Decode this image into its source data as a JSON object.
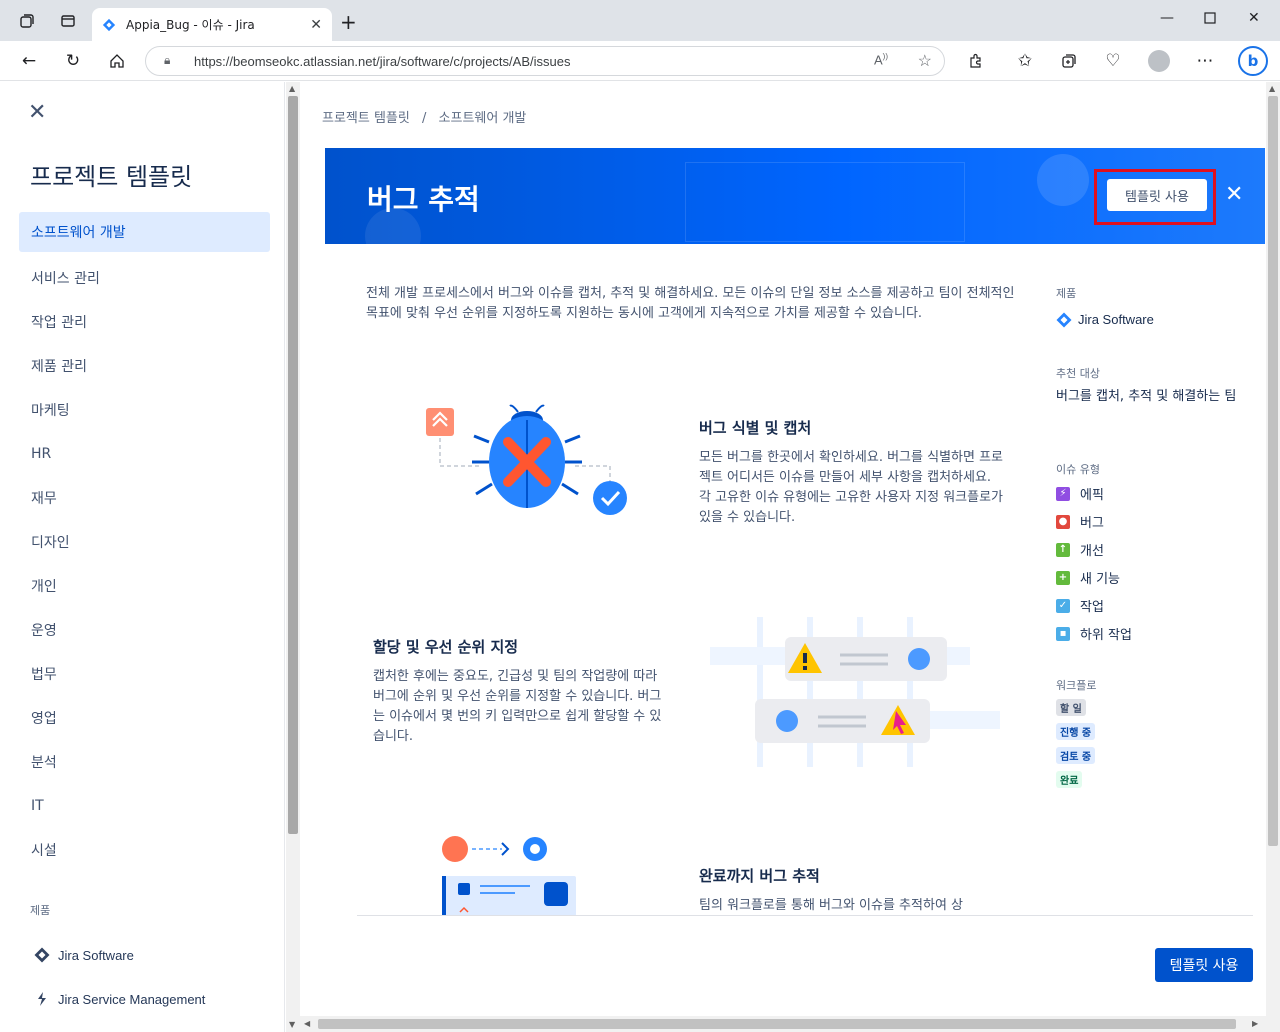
{
  "browser": {
    "tab_title": "Appia_Bug - 이슈 - Jira",
    "url": "https://beomseokc.atlassian.net/jira/software/c/projects/AB/issues"
  },
  "sidebar": {
    "title": "프로젝트 템플릿",
    "items": [
      {
        "label": "소프트웨어 개발",
        "active": true
      },
      {
        "label": "서비스 관리"
      },
      {
        "label": "작업 관리"
      },
      {
        "label": "제품 관리"
      },
      {
        "label": "마케팅"
      },
      {
        "label": "HR"
      },
      {
        "label": "재무"
      },
      {
        "label": "디자인"
      },
      {
        "label": "개인"
      },
      {
        "label": "운영"
      },
      {
        "label": "법무"
      },
      {
        "label": "영업"
      },
      {
        "label": "분석"
      },
      {
        "label": "IT"
      },
      {
        "label": "시설"
      }
    ],
    "products_label": "제품",
    "products": [
      "Jira Software",
      "Jira Service Management"
    ]
  },
  "breadcrumb": {
    "root": "프로젝트 템플릿",
    "separator": "/",
    "current": "소프트웨어 개발"
  },
  "banner": {
    "title": "버그 추적",
    "use_template_button": "템플릿 사용"
  },
  "description": "전체 개발 프로세스에서 버그와 이슈를 캡처, 추적 및 해결하세요. 모든 이슈의 단일 정보 소스를 제공하고 팀이 전체적인 목표에 맞춰 우선 순위를 지정하도록 지원하는 동시에 고객에게 지속적으로 가치를 제공할 수 있습니다.",
  "sections": [
    {
      "title": "버그 식별 및 캡처",
      "text": "모든 버그를 한곳에서 확인하세요. 버그를 식별하면 프로젝트 어디서든 이슈를 만들어 세부 사항을 캡처하세요. 각 고유한 이슈 유형에는 고유한 사용자 지정 워크플로가 있을 수 있습니다."
    },
    {
      "title": "할당 및 우선 순위 지정",
      "text": "캡처한 후에는 중요도, 긴급성 및 팀의 작업량에 따라 버그에 순위 및 우선 순위를 지정할 수 있습니다. 버그는 이슈에서 몇 번의 키 입력만으로 쉽게 할당할 수 있습니다."
    },
    {
      "title": "완료까지 버그 추적",
      "text": "팀의 워크플로를 통해 버그와 이슈를 추적하여 상"
    }
  ],
  "info": {
    "product_label": "제품",
    "product_value": "Jira Software",
    "recommended_label": "추천 대상",
    "recommended_value": "버그를 캡처, 추적 및 해결하는 팀",
    "issue_types_label": "이슈 유형",
    "issue_types": [
      {
        "label": "에픽",
        "color": "#904ee2",
        "glyph": "⚡"
      },
      {
        "label": "버그",
        "color": "#e2483d",
        "glyph": "●"
      },
      {
        "label": "개선",
        "color": "#63ba3c",
        "glyph": "↑"
      },
      {
        "label": "새 기능",
        "color": "#63ba3c",
        "glyph": "+"
      },
      {
        "label": "작업",
        "color": "#4bade8",
        "glyph": "✓"
      },
      {
        "label": "하위 작업",
        "color": "#4bade8",
        "glyph": "▪"
      }
    ],
    "workflow_label": "워크플로",
    "workflow": [
      {
        "label": "할 일",
        "bg": "#dfe1e6",
        "fg": "#42526e"
      },
      {
        "label": "진행 중",
        "bg": "#deebff",
        "fg": "#0747a6"
      },
      {
        "label": "검토 중",
        "bg": "#deebff",
        "fg": "#0747a6"
      },
      {
        "label": "완료",
        "bg": "#e3fcef",
        "fg": "#006644"
      }
    ]
  },
  "footer": {
    "use_template_button": "템플릿 사용"
  },
  "colors": {
    "accent": "#0052cc",
    "highlight": "#e0101f"
  }
}
